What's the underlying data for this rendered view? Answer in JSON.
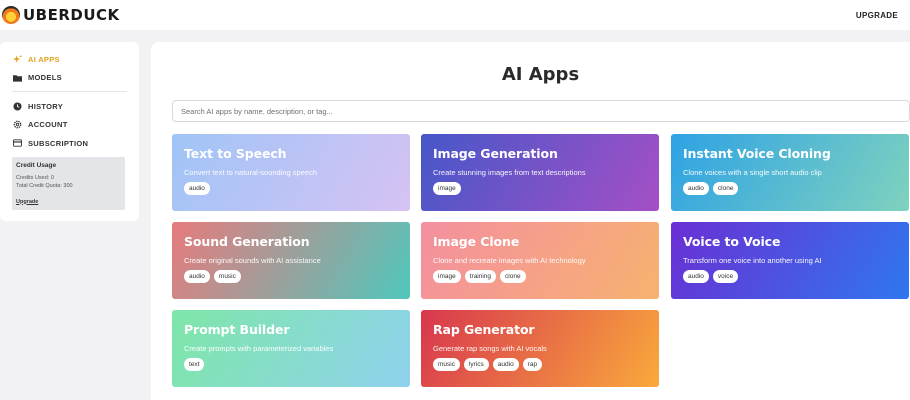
{
  "header": {
    "brand": "UBERDUCK",
    "upgrade": "UPGRADE"
  },
  "sidebar": {
    "items": [
      {
        "label": "AI APPS",
        "icon": "sparkle-icon"
      },
      {
        "label": "MODELS",
        "icon": "folder-icon"
      },
      {
        "label": "HISTORY",
        "icon": "clock-icon"
      },
      {
        "label": "ACCOUNT",
        "icon": "gear-icon"
      },
      {
        "label": "SUBSCRIPTION",
        "icon": "card-icon"
      }
    ],
    "credit": {
      "title": "Credit Usage",
      "used": "Credits Used: 0",
      "quota": "Total Credit Quota: 300",
      "upgrade": "Upgrade"
    }
  },
  "main": {
    "title": "AI Apps",
    "search_placeholder": "Search AI apps by name, description, or tag...",
    "apps": [
      {
        "title": "Text to Speech",
        "desc": "Convert text to natural-sounding speech",
        "tags": [
          "audio"
        ],
        "colors": [
          "#a0c4f6",
          "#d6c2f4"
        ]
      },
      {
        "title": "Image Generation",
        "desc": "Create stunning images from text descriptions",
        "tags": [
          "image"
        ],
        "colors": [
          "#4657c8",
          "#a54fc6"
        ]
      },
      {
        "title": "Instant Voice Cloning",
        "desc": "Clone voices with a single short audio clip",
        "tags": [
          "audio",
          "clone"
        ],
        "colors": [
          "#2ea2e4",
          "#7fd2be"
        ]
      },
      {
        "title": "Sound Generation",
        "desc": "Create original sounds with AI assistance",
        "tags": [
          "audio",
          "music"
        ],
        "colors": [
          "#e77a7c",
          "#4fc7bc"
        ]
      },
      {
        "title": "Image Clone",
        "desc": "Clone and recreate images with AI technology",
        "tags": [
          "image",
          "training",
          "clone"
        ],
        "colors": [
          "#f48fa0",
          "#f7b26f"
        ]
      },
      {
        "title": "Voice to Voice",
        "desc": "Transform one voice into another using AI",
        "tags": [
          "audio",
          "voice"
        ],
        "colors": [
          "#6a2fd4",
          "#2f77ee"
        ]
      },
      {
        "title": "Prompt Builder",
        "desc": "Create prompts with parameterized variables",
        "tags": [
          "text"
        ],
        "colors": [
          "#7ee6a8",
          "#8fd2ee"
        ]
      },
      {
        "title": "Rap Generator",
        "desc": "Generate rap songs with AI vocals",
        "tags": [
          "music",
          "lyrics",
          "audio",
          "rap"
        ],
        "colors": [
          "#d8374e",
          "#f9a93c"
        ]
      }
    ]
  }
}
